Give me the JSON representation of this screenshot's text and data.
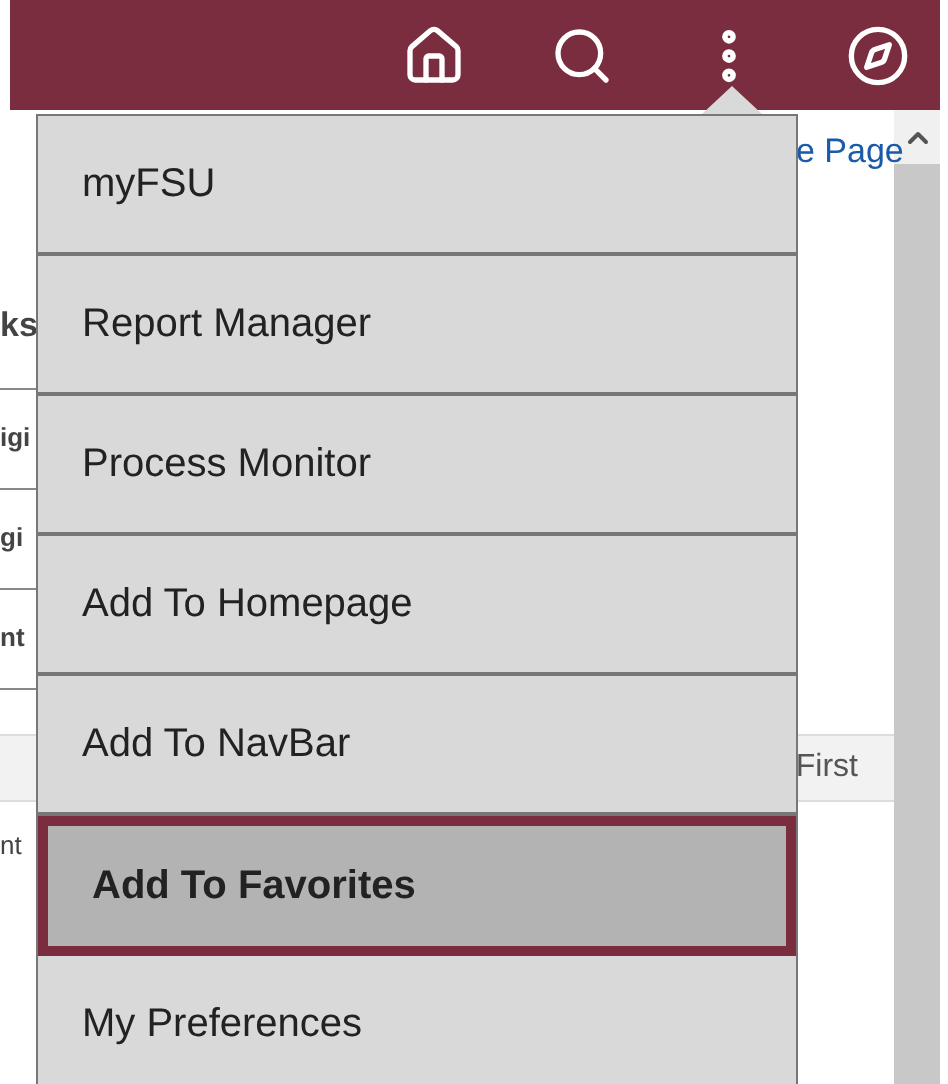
{
  "header": {
    "icons": [
      {
        "kind": "home"
      },
      {
        "kind": "search"
      },
      {
        "kind": "more"
      },
      {
        "kind": "compass"
      }
    ]
  },
  "page_fragments": {
    "link": "e Page",
    "column_texts": [
      "ks",
      "igi",
      "gi",
      "nt"
    ],
    "table_header": "First",
    "table_cell": "nt"
  },
  "menu": {
    "items": [
      {
        "label": "myFSU",
        "selected": false
      },
      {
        "label": "Report Manager",
        "selected": false
      },
      {
        "label": "Process Monitor",
        "selected": false
      },
      {
        "label": "Add To Homepage",
        "selected": false
      },
      {
        "label": "Add To NavBar",
        "selected": false
      },
      {
        "label": "Add To Favorites",
        "selected": true
      },
      {
        "label": "My Preferences",
        "selected": false
      }
    ]
  }
}
